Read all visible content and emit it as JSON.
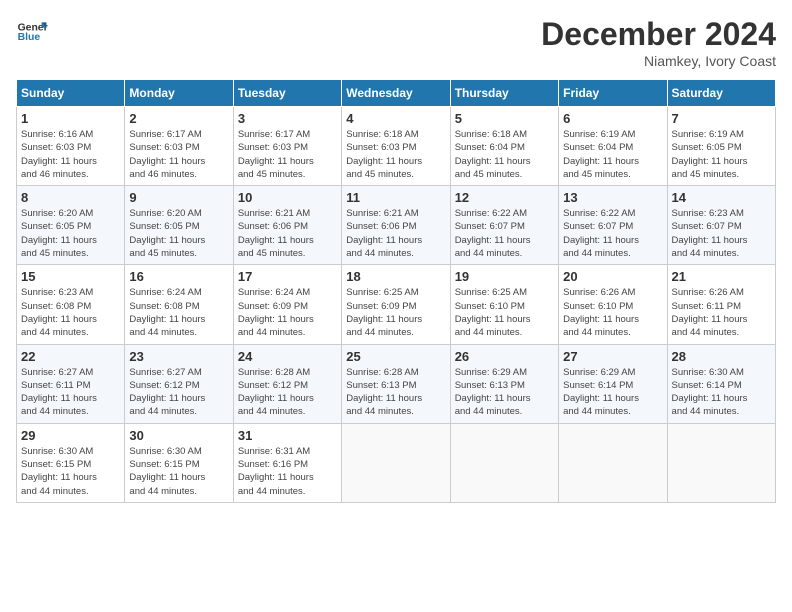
{
  "header": {
    "logo_line1": "General",
    "logo_line2": "Blue",
    "month": "December 2024",
    "location": "Niamkey, Ivory Coast"
  },
  "weekdays": [
    "Sunday",
    "Monday",
    "Tuesday",
    "Wednesday",
    "Thursday",
    "Friday",
    "Saturday"
  ],
  "weeks": [
    [
      {
        "day": "1",
        "info": "Sunrise: 6:16 AM\nSunset: 6:03 PM\nDaylight: 11 hours\nand 46 minutes."
      },
      {
        "day": "2",
        "info": "Sunrise: 6:17 AM\nSunset: 6:03 PM\nDaylight: 11 hours\nand 46 minutes."
      },
      {
        "day": "3",
        "info": "Sunrise: 6:17 AM\nSunset: 6:03 PM\nDaylight: 11 hours\nand 45 minutes."
      },
      {
        "day": "4",
        "info": "Sunrise: 6:18 AM\nSunset: 6:03 PM\nDaylight: 11 hours\nand 45 minutes."
      },
      {
        "day": "5",
        "info": "Sunrise: 6:18 AM\nSunset: 6:04 PM\nDaylight: 11 hours\nand 45 minutes."
      },
      {
        "day": "6",
        "info": "Sunrise: 6:19 AM\nSunset: 6:04 PM\nDaylight: 11 hours\nand 45 minutes."
      },
      {
        "day": "7",
        "info": "Sunrise: 6:19 AM\nSunset: 6:05 PM\nDaylight: 11 hours\nand 45 minutes."
      }
    ],
    [
      {
        "day": "8",
        "info": "Sunrise: 6:20 AM\nSunset: 6:05 PM\nDaylight: 11 hours\nand 45 minutes."
      },
      {
        "day": "9",
        "info": "Sunrise: 6:20 AM\nSunset: 6:05 PM\nDaylight: 11 hours\nand 45 minutes."
      },
      {
        "day": "10",
        "info": "Sunrise: 6:21 AM\nSunset: 6:06 PM\nDaylight: 11 hours\nand 45 minutes."
      },
      {
        "day": "11",
        "info": "Sunrise: 6:21 AM\nSunset: 6:06 PM\nDaylight: 11 hours\nand 44 minutes."
      },
      {
        "day": "12",
        "info": "Sunrise: 6:22 AM\nSunset: 6:07 PM\nDaylight: 11 hours\nand 44 minutes."
      },
      {
        "day": "13",
        "info": "Sunrise: 6:22 AM\nSunset: 6:07 PM\nDaylight: 11 hours\nand 44 minutes."
      },
      {
        "day": "14",
        "info": "Sunrise: 6:23 AM\nSunset: 6:07 PM\nDaylight: 11 hours\nand 44 minutes."
      }
    ],
    [
      {
        "day": "15",
        "info": "Sunrise: 6:23 AM\nSunset: 6:08 PM\nDaylight: 11 hours\nand 44 minutes."
      },
      {
        "day": "16",
        "info": "Sunrise: 6:24 AM\nSunset: 6:08 PM\nDaylight: 11 hours\nand 44 minutes."
      },
      {
        "day": "17",
        "info": "Sunrise: 6:24 AM\nSunset: 6:09 PM\nDaylight: 11 hours\nand 44 minutes."
      },
      {
        "day": "18",
        "info": "Sunrise: 6:25 AM\nSunset: 6:09 PM\nDaylight: 11 hours\nand 44 minutes."
      },
      {
        "day": "19",
        "info": "Sunrise: 6:25 AM\nSunset: 6:10 PM\nDaylight: 11 hours\nand 44 minutes."
      },
      {
        "day": "20",
        "info": "Sunrise: 6:26 AM\nSunset: 6:10 PM\nDaylight: 11 hours\nand 44 minutes."
      },
      {
        "day": "21",
        "info": "Sunrise: 6:26 AM\nSunset: 6:11 PM\nDaylight: 11 hours\nand 44 minutes."
      }
    ],
    [
      {
        "day": "22",
        "info": "Sunrise: 6:27 AM\nSunset: 6:11 PM\nDaylight: 11 hours\nand 44 minutes."
      },
      {
        "day": "23",
        "info": "Sunrise: 6:27 AM\nSunset: 6:12 PM\nDaylight: 11 hours\nand 44 minutes."
      },
      {
        "day": "24",
        "info": "Sunrise: 6:28 AM\nSunset: 6:12 PM\nDaylight: 11 hours\nand 44 minutes."
      },
      {
        "day": "25",
        "info": "Sunrise: 6:28 AM\nSunset: 6:13 PM\nDaylight: 11 hours\nand 44 minutes."
      },
      {
        "day": "26",
        "info": "Sunrise: 6:29 AM\nSunset: 6:13 PM\nDaylight: 11 hours\nand 44 minutes."
      },
      {
        "day": "27",
        "info": "Sunrise: 6:29 AM\nSunset: 6:14 PM\nDaylight: 11 hours\nand 44 minutes."
      },
      {
        "day": "28",
        "info": "Sunrise: 6:30 AM\nSunset: 6:14 PM\nDaylight: 11 hours\nand 44 minutes."
      }
    ],
    [
      {
        "day": "29",
        "info": "Sunrise: 6:30 AM\nSunset: 6:15 PM\nDaylight: 11 hours\nand 44 minutes."
      },
      {
        "day": "30",
        "info": "Sunrise: 6:30 AM\nSunset: 6:15 PM\nDaylight: 11 hours\nand 44 minutes."
      },
      {
        "day": "31",
        "info": "Sunrise: 6:31 AM\nSunset: 6:16 PM\nDaylight: 11 hours\nand 44 minutes."
      },
      {
        "day": "",
        "info": ""
      },
      {
        "day": "",
        "info": ""
      },
      {
        "day": "",
        "info": ""
      },
      {
        "day": "",
        "info": ""
      }
    ]
  ]
}
